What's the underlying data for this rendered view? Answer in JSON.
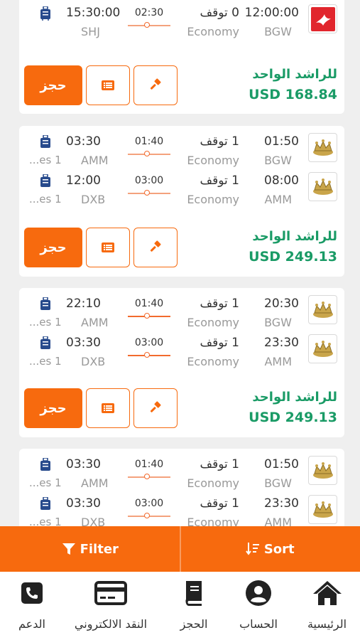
{
  "brand": {
    "accent": "#f76a0e",
    "price_color": "#1a9b66"
  },
  "results": [
    {
      "segments": [
        {
          "airline_logo": "bird-logo-icon",
          "dep_time": "12:00:00",
          "dep_code": "BGW",
          "stops": "0 توقف",
          "cabin": "Economy",
          "duration": "02:30",
          "arr_time": "15:30:00",
          "arr_code": "SHJ",
          "bag_note": ""
        }
      ],
      "price_label": "للراشد الواحد",
      "price": "USD 168.84",
      "book_label": "حجز"
    },
    {
      "segments": [
        {
          "airline_logo": "crown-logo-icon",
          "dep_time": "01:50",
          "dep_code": "BGW",
          "stops": "1 توقف",
          "cabin": "Economy",
          "duration": "01:40",
          "arr_time": "03:30",
          "arr_code": "AMM",
          "bag_note": "...es 1"
        },
        {
          "airline_logo": "crown-logo-icon",
          "dep_time": "08:00",
          "dep_code": "AMM",
          "stops": "1 توقف",
          "cabin": "Economy",
          "duration": "03:00",
          "arr_time": "12:00",
          "arr_code": "DXB",
          "bag_note": "...es 1"
        }
      ],
      "price_label": "للراشد الواحد",
      "price": "USD 249.13",
      "book_label": "حجز"
    },
    {
      "segments": [
        {
          "airline_logo": "crown-logo-icon",
          "dep_time": "20:30",
          "dep_code": "BGW",
          "stops": "1 توقف",
          "cabin": "Economy",
          "duration": "01:40",
          "arr_time": "22:10",
          "arr_code": "AMM",
          "bag_note": "...es 1"
        },
        {
          "airline_logo": "crown-logo-icon",
          "dep_time": "23:30",
          "dep_code": "AMM",
          "stops": "1 توقف",
          "cabin": "Economy",
          "duration": "03:00",
          "arr_time": "03:30",
          "arr_code": "DXB",
          "bag_note": "...es 1"
        }
      ],
      "price_label": "للراشد الواحد",
      "price": "USD 249.13",
      "book_label": "حجز"
    },
    {
      "segments": [
        {
          "airline_logo": "crown-logo-icon",
          "dep_time": "01:50",
          "dep_code": "BGW",
          "stops": "1 توقف",
          "cabin": "Economy",
          "duration": "01:40",
          "arr_time": "03:30",
          "arr_code": "AMM",
          "bag_note": "...es 1"
        },
        {
          "airline_logo": "crown-logo-icon",
          "dep_time": "23:30",
          "dep_code": "AMM",
          "stops": "1 توقف",
          "cabin": "Economy",
          "duration": "03:00",
          "arr_time": "03:30",
          "arr_code": "DXB",
          "bag_note": "...es 1"
        }
      ]
    }
  ],
  "toolbar": {
    "filter_label": "Filter",
    "sort_label": "Sort"
  },
  "nav": {
    "home": "الرئيسية",
    "account": "الحساب",
    "booking": "الحجز",
    "ewallet": "النقد الالكتروني",
    "support": "الدعم"
  }
}
